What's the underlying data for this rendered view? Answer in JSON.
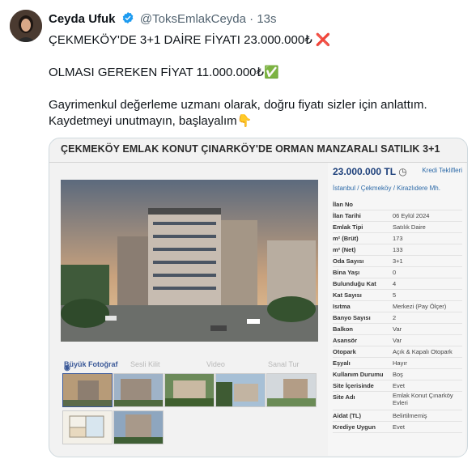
{
  "tweet": {
    "author_name": "Ceyda Ufuk",
    "handle": "@ToksEmlakCeyda",
    "separator": "·",
    "time": "13s",
    "line1": "ÇEKMEKÖY'DE 3+1 DAİRE FİYATI 23.000.000₺ ❌",
    "line2": "OLMASI GEREKEN FİYAT 11.000.000₺✅",
    "line3": "Gayrimenkul değerleme uzmanı olarak, doğru fiyatı sizler için anlattım. Kaydetmeyi unutmayın, başlayalım👇"
  },
  "listing": {
    "title": "ÇEKMEKÖY EMLAK KONUT ÇINARKÖY'DE ORMAN MANZARALI SATILIK 3+1",
    "price": "23.000.000 TL",
    "credit_link": "Kredi Teklifleri",
    "location": "İstanbul  /  Çekmeköy  /  Kirazlıdere Mh.",
    "tabs": [
      "Büyük Fotoğraf",
      "Sesli Kilit",
      "Video",
      "Sanal Tur"
    ],
    "details": [
      {
        "k": "İlan No",
        "v": ""
      },
      {
        "k": "İlan Tarihi",
        "v": "06 Eylül 2024"
      },
      {
        "k": "Emlak Tipi",
        "v": "Satılık Daire"
      },
      {
        "k": "m² (Brüt)",
        "v": "173"
      },
      {
        "k": "m² (Net)",
        "v": "133"
      },
      {
        "k": "Oda Sayısı",
        "v": "3+1"
      },
      {
        "k": "Bina Yaşı",
        "v": "0"
      },
      {
        "k": "Bulunduğu Kat",
        "v": "4"
      },
      {
        "k": "Kat Sayısı",
        "v": "5"
      },
      {
        "k": "Isıtma",
        "v": "Merkezi (Pay Ölçer)"
      },
      {
        "k": "Banyo Sayısı",
        "v": "2"
      },
      {
        "k": "Balkon",
        "v": "Var"
      },
      {
        "k": "Asansör",
        "v": "Var"
      },
      {
        "k": "Otopark",
        "v": "Açık & Kapalı Otopark"
      },
      {
        "k": "Eşyalı",
        "v": "Hayır"
      },
      {
        "k": "Kullanım Durumu",
        "v": "Boş"
      },
      {
        "k": "Site İçerisinde",
        "v": "Evet"
      },
      {
        "k": "Site Adı",
        "v": "Emlak Konut Çınarköy Evleri"
      },
      {
        "k": "Aidat (TL)",
        "v": "Belirtilmemiş"
      },
      {
        "k": "Krediye Uygun",
        "v": "Evet"
      }
    ]
  },
  "colors": {
    "verified": "#1d9bf0",
    "price": "#1c3f7a",
    "link": "#2d6aa8"
  },
  "icons": [
    "verified-badge-icon",
    "history-icon",
    "camera-icon"
  ]
}
